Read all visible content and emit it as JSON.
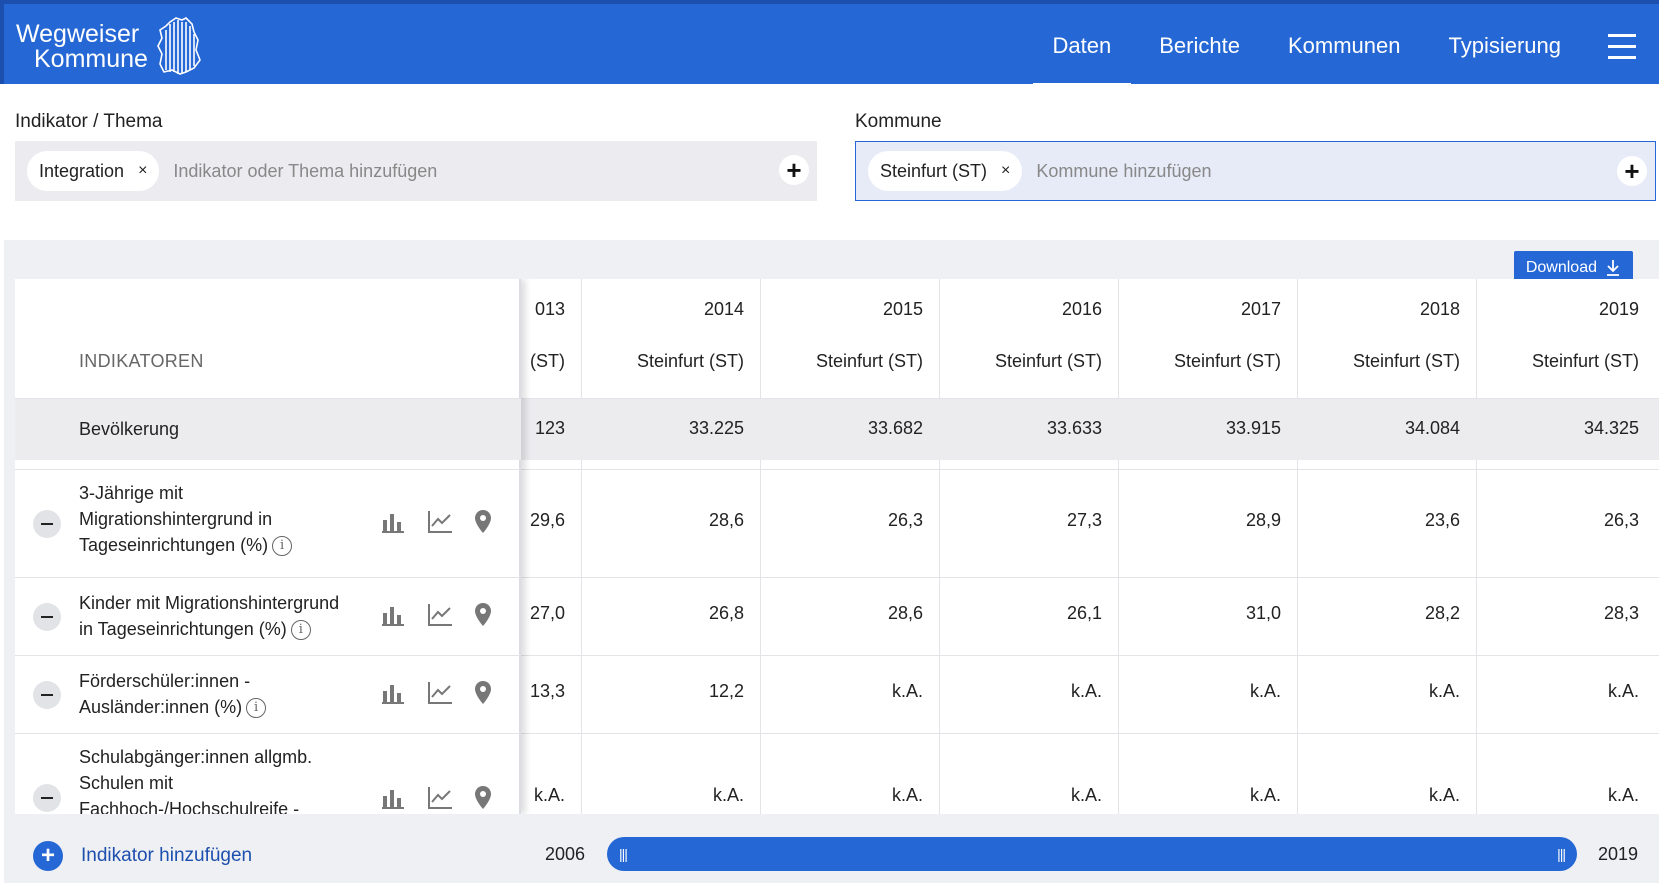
{
  "header": {
    "logo_line1": "Wegweiser",
    "logo_line2": "Kommune",
    "nav": [
      {
        "label": "Daten",
        "active": true
      },
      {
        "label": "Berichte"
      },
      {
        "label": "Kommunen"
      },
      {
        "label": "Typisierung"
      }
    ]
  },
  "filters": {
    "indicator_label": "Indikator / Thema",
    "indicator_chip": "Integration",
    "indicator_placeholder": "Indikator oder Thema hinzufügen",
    "kommune_label": "Kommune",
    "kommune_chip": "Steinfurt (ST)",
    "kommune_placeholder": "Kommune hinzufügen",
    "chip_remove": "×",
    "add_symbol": "+"
  },
  "table": {
    "download_label": "Download",
    "indikatoren_header": "INDIKATOREN",
    "years": [
      "013",
      "2014",
      "2015",
      "2016",
      "2017",
      "2018",
      "2019"
    ],
    "kommunen": [
      "(ST)",
      "Steinfurt (ST)",
      "Steinfurt (ST)",
      "Steinfurt (ST)",
      "Steinfurt (ST)",
      "Steinfurt (ST)",
      "Steinfurt (ST)"
    ],
    "population": {
      "label": "Bevölkerung",
      "values": [
        "123",
        "33.225",
        "33.682",
        "33.633",
        "33.915",
        "34.084",
        "34.325"
      ]
    },
    "rows": [
      {
        "label": "3-Jährige mit Migrationshintergrund in Tageseinrichtungen (%)",
        "values": [
          "29,6",
          "28,6",
          "26,3",
          "27,3",
          "28,9",
          "23,6",
          "26,3"
        ]
      },
      {
        "label": "Kinder mit Migrationshintergrund in Tageseinrichtungen (%)",
        "values": [
          "27,0",
          "26,8",
          "28,6",
          "26,1",
          "31,0",
          "28,2",
          "28,3"
        ]
      },
      {
        "label": "Förderschüler:innen - Ausländer:innen (%)",
        "values": [
          "13,3",
          "12,2",
          "k.A.",
          "k.A.",
          "k.A.",
          "k.A.",
          "k.A."
        ]
      },
      {
        "label": "Schulabgänger:innen allgmb. Schulen mit Fachhoch-/Hochschulreife -",
        "values": [
          "k.A.",
          "k.A.",
          "k.A.",
          "k.A.",
          "k.A.",
          "k.A.",
          "k.A."
        ]
      }
    ]
  },
  "footer": {
    "add_indicator": "Indikator hinzufügen",
    "add_symbol": "+",
    "year_start": "2006",
    "year_end": "2019",
    "handle_glyph": "|||"
  },
  "icons": [
    "bar-chart-icon",
    "line-chart-icon",
    "map-pin-icon",
    "info-icon",
    "download-icon",
    "menu-icon",
    "germany-map-logo"
  ],
  "colors": {
    "brand": "#2567d4",
    "icon_gray": "#777777"
  }
}
